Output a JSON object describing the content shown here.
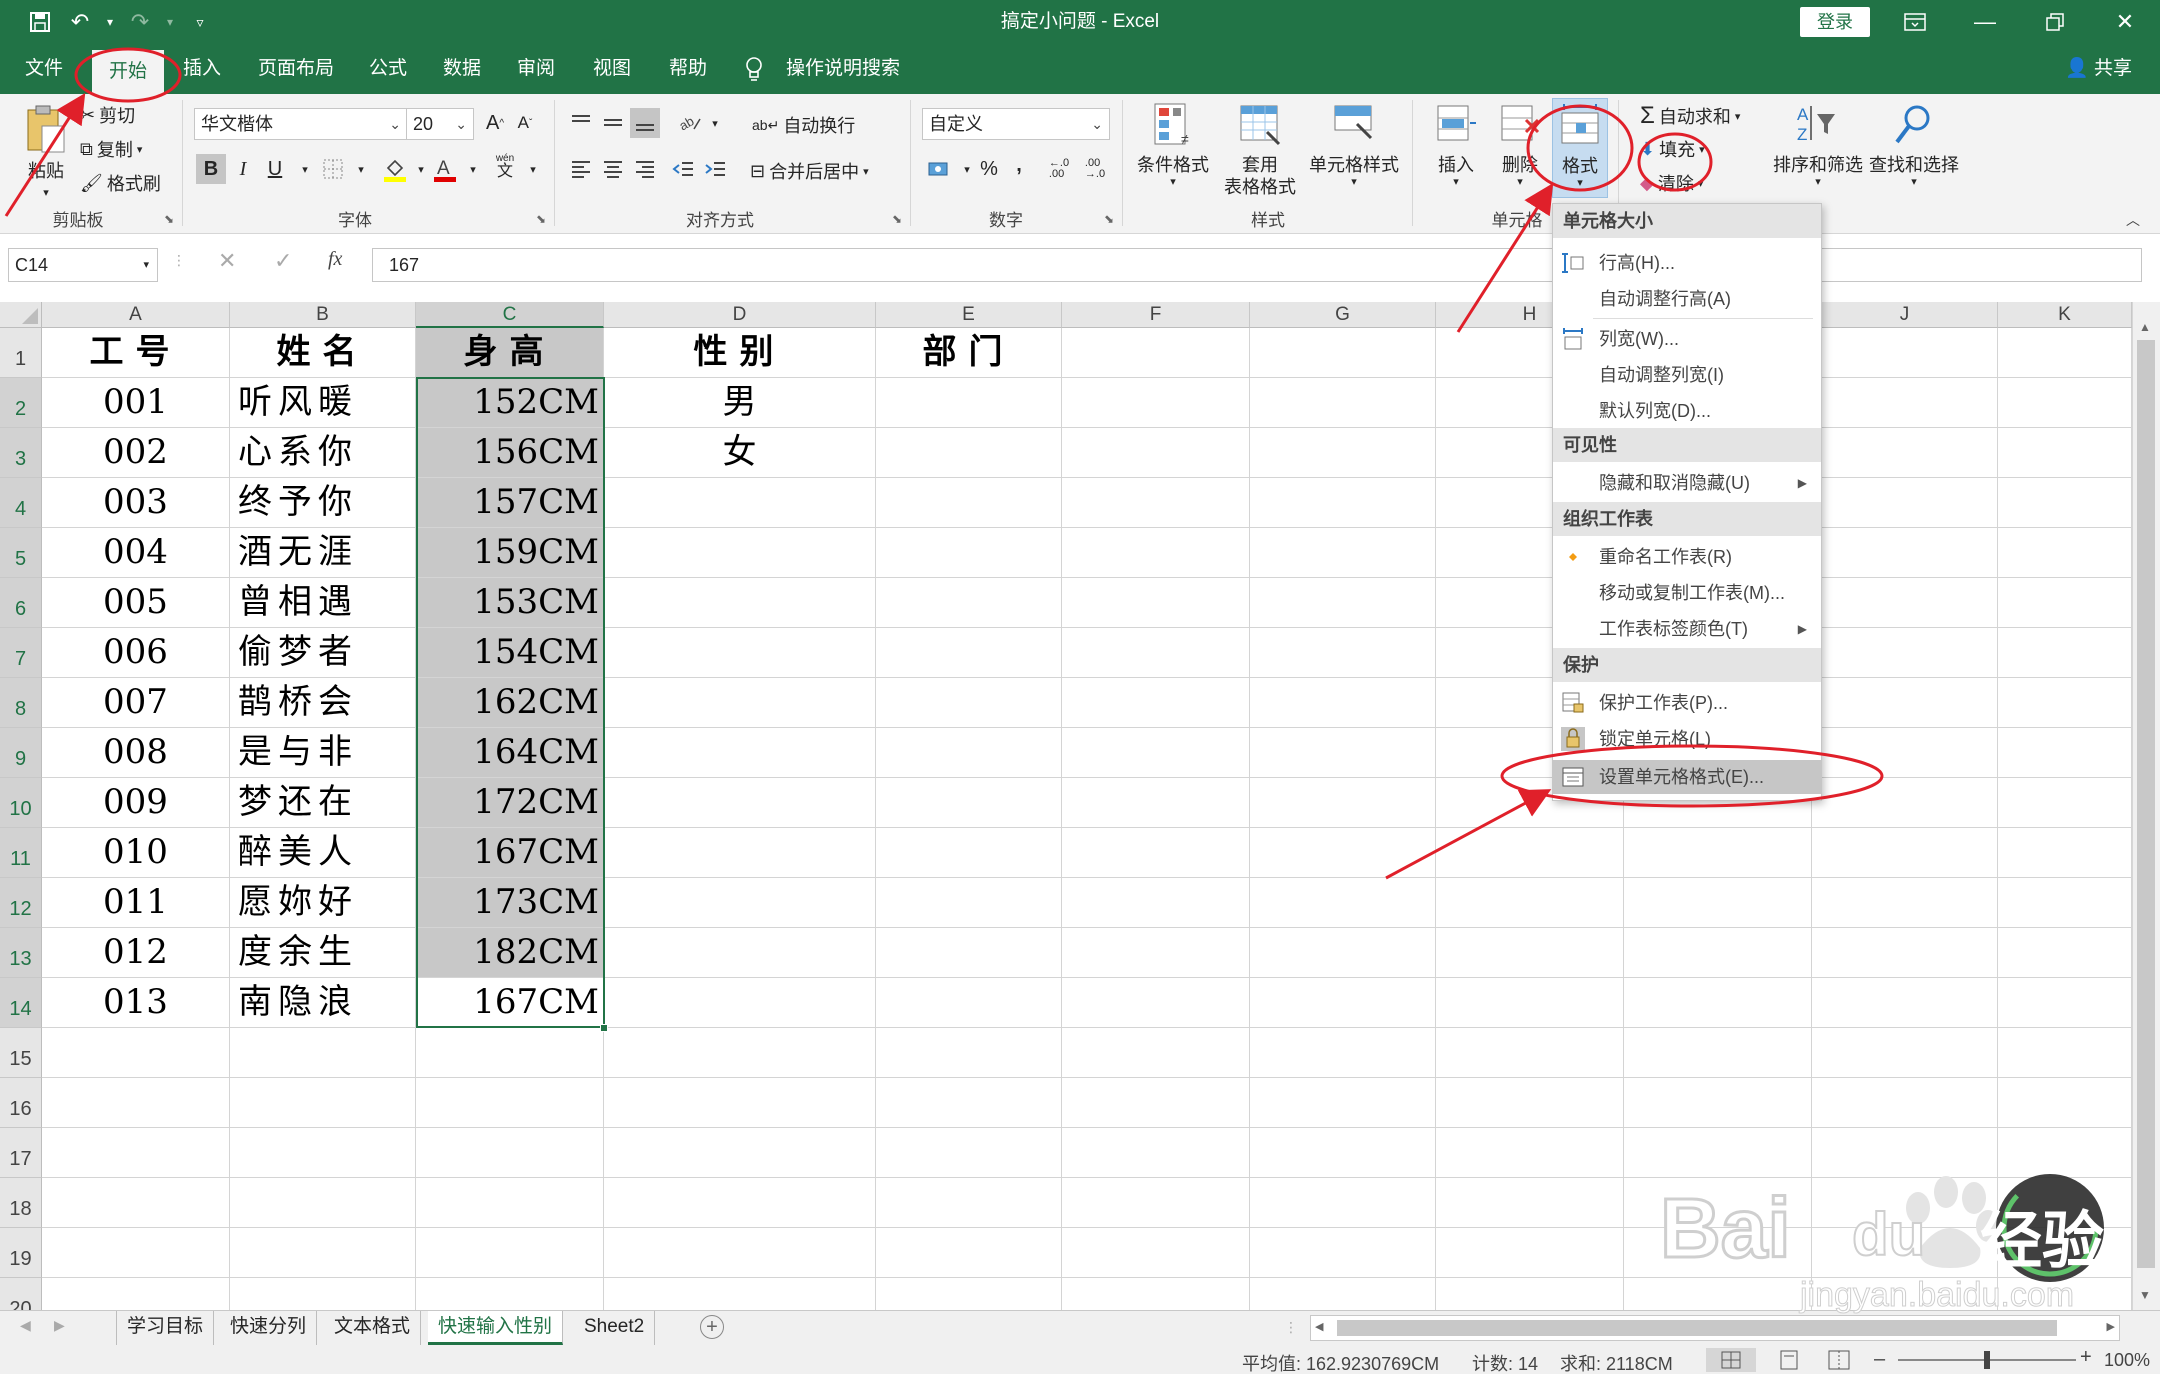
{
  "titlebar": {
    "title": "搞定小问题  -  Excel",
    "login_label": "登录",
    "save_icon": "save-icon",
    "undo_icon": "undo-icon",
    "redo_icon": "redo-icon"
  },
  "menu_tabs": [
    "文件",
    "开始",
    "插入",
    "页面布局",
    "公式",
    "数据",
    "审阅",
    "视图",
    "帮助"
  ],
  "active_tab": "开始",
  "tell_me": "操作说明搜索",
  "share": "共享",
  "ribbon": {
    "clipboard": {
      "label": "剪贴板",
      "paste": "粘贴",
      "cut": "剪切",
      "copy": "复制",
      "format_painter": "格式刷"
    },
    "font": {
      "label": "字体",
      "font_name": "华文楷体",
      "font_size": "20",
      "bold": "B",
      "italic": "I",
      "underline": "U",
      "grow": "A",
      "shrink": "A",
      "wen": "wén",
      "wen2": "文"
    },
    "alignment": {
      "label": "对齐方式",
      "wrap": "自动换行",
      "merge": "合并后居中"
    },
    "number": {
      "label": "数字",
      "format": "自定义",
      "percent": "%",
      "comma": ","
    },
    "styles": {
      "label": "样式",
      "conditional": "条件格式",
      "table_line1": "套用",
      "table_line2": "表格格式",
      "cell_styles": "单元格样式"
    },
    "cells": {
      "label": "单元格",
      "insert": "插入",
      "delete": "删除",
      "format": "格式"
    },
    "editing": {
      "autosum": "自动求和",
      "fill": "填充",
      "clear": "清除",
      "sort": "排序和筛选",
      "find": "查找和选择"
    }
  },
  "formula_bar": {
    "name_box": "C14",
    "fx": "fx",
    "value": "167"
  },
  "columns": [
    "A",
    "B",
    "C",
    "D",
    "E",
    "F",
    "G",
    "H",
    "I",
    "J",
    "K"
  ],
  "rows": [
    "1",
    "2",
    "3",
    "4",
    "5",
    "6",
    "7",
    "8",
    "9",
    "10",
    "11",
    "12",
    "13",
    "14",
    "15",
    "16",
    "17",
    "18",
    "19",
    "20"
  ],
  "sheet_data": {
    "headers": {
      "a": "工号",
      "b": "姓名",
      "c": "身高",
      "d": "性别",
      "e": "部门"
    },
    "ids": [
      "001",
      "002",
      "003",
      "004",
      "005",
      "006",
      "007",
      "008",
      "009",
      "010",
      "011",
      "012",
      "013"
    ],
    "names": [
      "听风暖",
      "心系你",
      "终予你",
      "酒无涯",
      "曾相遇",
      "偷梦者",
      "鹊桥会",
      "是与非",
      "梦还在",
      "醉美人",
      "愿妳好",
      "度余生",
      "南隐浪"
    ],
    "heights": [
      "152CM",
      "156CM",
      "157CM",
      "159CM",
      "153CM",
      "154CM",
      "162CM",
      "164CM",
      "172CM",
      "167CM",
      "173CM",
      "182CM",
      "167CM"
    ],
    "gender": [
      "男",
      "女"
    ]
  },
  "format_menu": {
    "section_size": "单元格大小",
    "row_height": "行高(H)...",
    "autofit_row": "自动调整行高(A)",
    "col_width": "列宽(W)...",
    "autofit_col": "自动调整列宽(I)",
    "default_width": "默认列宽(D)...",
    "section_visibility": "可见性",
    "hide_unhide": "隐藏和取消隐藏(U)",
    "section_organize": "组织工作表",
    "rename": "重命名工作表(R)",
    "move_copy": "移动或复制工作表(M)...",
    "tab_color": "工作表标签颜色(T)",
    "section_protect": "保护",
    "protect_sheet": "保护工作表(P)...",
    "lock_cell": "锁定单元格(L)",
    "format_cells": "设置单元格格式(E)..."
  },
  "sheet_tabs": [
    "学习目标",
    "快速分列",
    "文本格式",
    "快速输入性别",
    "Sheet2"
  ],
  "active_sheet": "快速输入性别",
  "status": {
    "average": "平均值: 162.9230769CM",
    "count": "计数: 14",
    "sum": "求和: 2118CM",
    "zoom": "100%"
  },
  "watermark": {
    "brand": "Bai",
    "brand2": "du",
    "jingyan": "经验",
    "url": "jingyan.baidu.com"
  },
  "colors": {
    "excel_green": "#217346",
    "annotation_red": "#e0202a",
    "selection_gray": "#c8c8c8"
  }
}
